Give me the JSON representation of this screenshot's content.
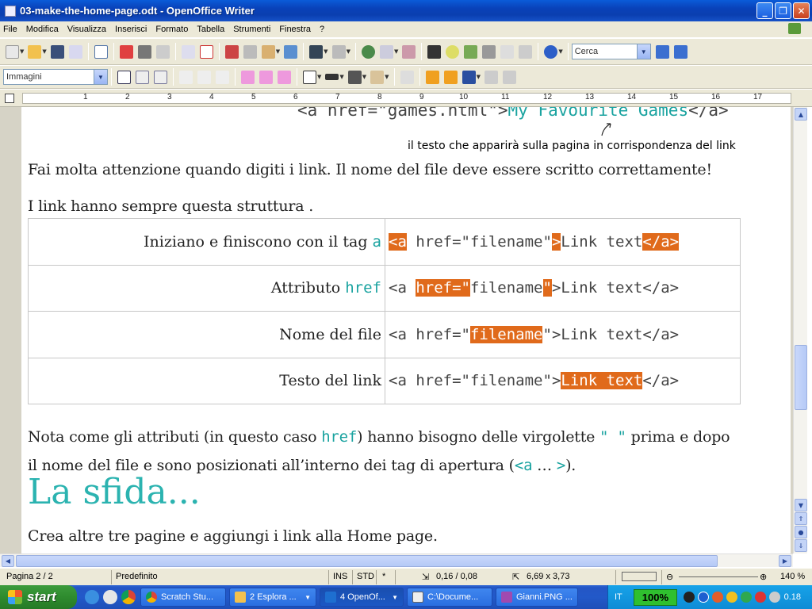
{
  "window": {
    "title": "03-make-the-home-page.odt - OpenOffice Writer"
  },
  "menu": [
    "File",
    "Modifica",
    "Visualizza",
    "Inserisci",
    "Formato",
    "Tabella",
    "Strumenti",
    "Finestra",
    "?"
  ],
  "toolbar": {
    "search_placeholder": "Cerca",
    "style_value": "Immagini"
  },
  "ruler": {
    "ticks": [
      "1",
      "2",
      "3",
      "4",
      "5",
      "6",
      "7",
      "8",
      "9",
      "10",
      "11",
      "12",
      "13",
      "14",
      "15",
      "16",
      "17"
    ]
  },
  "document": {
    "top_code": {
      "pre": "<a href=\"games.html\">",
      "link": "My Favourite Games",
      "post": "</a>"
    },
    "annotation": "il testo che apparirà sulla pagina in corrispondenza del link",
    "para1": "Fai molta attenzione quando digiti i link. Il nome del file deve essere scritto correttamente!",
    "para2": "I link hanno sempre questa struttura .",
    "table": {
      "rows": [
        {
          "label": "Iniziano e finiscono con il tag",
          "keyword": "a"
        },
        {
          "label": "Attributo",
          "keyword": "href"
        },
        {
          "label": "Nome del file",
          "keyword": ""
        },
        {
          "label": "Testo del link",
          "keyword": ""
        }
      ],
      "code_parts": {
        "open_a": "<a",
        "href": " href=\"",
        "filename": "filename",
        "quote": "\"",
        "gt": ">",
        "link_text": "Link text",
        "close_a": "</a>",
        "space": " "
      }
    },
    "para3": {
      "a": "Nota come gli attributi (in questo caso ",
      "code1": "href",
      "b": ") hanno bisogno delle virgolette ",
      "code2": "\" \"",
      "c": " prima e dopo il nome del file e sono posizionati all’interno dei tag di apertura (",
      "code3": "<a",
      "d": " … ",
      "code4": ">",
      "e": ")."
    },
    "heading": "La sfida...",
    "para4": "Crea altre tre pagine e aggiungi i link alla Home page."
  },
  "status": {
    "page": "Pagina 2 / 2",
    "style": "Predefinito",
    "ins": "INS",
    "std": "STD",
    "star": "*",
    "position": "0,16 / 0,08",
    "size": "6,69 x 3,73",
    "zoom": "140 %"
  },
  "taskbar": {
    "start": "start",
    "tasks": [
      "Scratch Stu...",
      "2 Esplora ...",
      "4 OpenOf...",
      "C:\\Docume...",
      "Gianni.PNG ..."
    ],
    "lang": "IT",
    "battery": "100%",
    "clock": "0.18"
  },
  "colors": {
    "highlight": "#e06a1b",
    "teal": "#1aa3a0"
  }
}
